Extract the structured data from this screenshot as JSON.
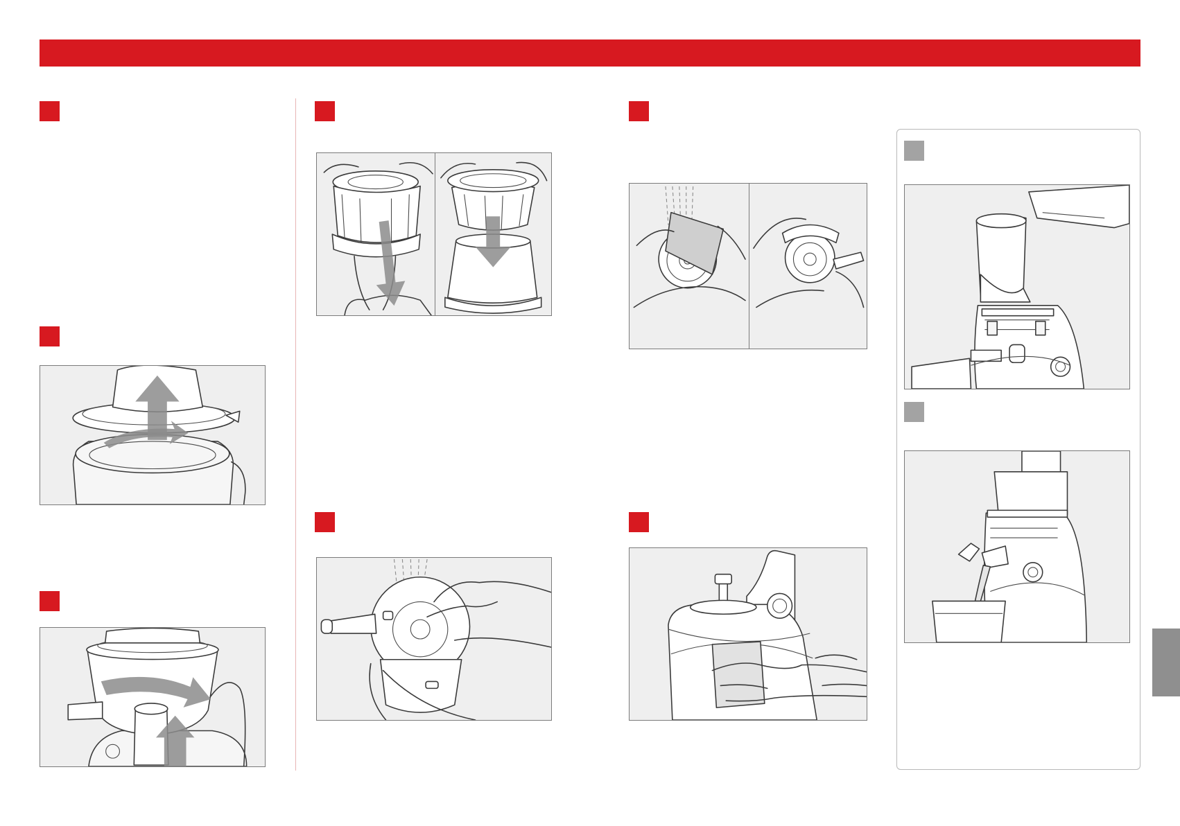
{
  "colors": {
    "brand_red": "#d71920",
    "tip_grey": "#a3a3a3",
    "side_tab_grey": "#8f8f8f",
    "illustration_bg": "#efefef"
  },
  "icons": {
    "step_marker": "red-square",
    "tip_marker": "grey-square",
    "motion_arrow": "grey-arrow",
    "water_spray": "dashed-lines"
  },
  "illustrations": [
    "lift-hopper-off",
    "remove-drum",
    "separate-brush-and-strainer",
    "rinse-hopper",
    "clean-screw",
    "wipe-body",
    "pour-into-hopper",
    "juice-into-glass"
  ]
}
